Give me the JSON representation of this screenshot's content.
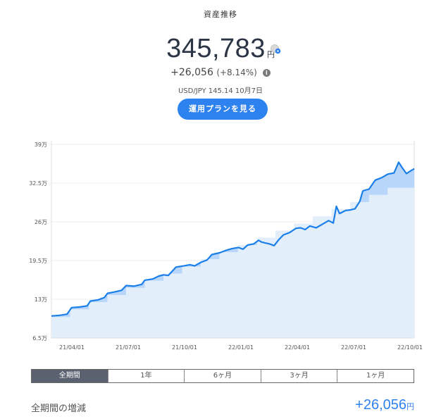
{
  "header": {
    "title": "資産推移"
  },
  "balance": {
    "amount": "345,783",
    "unit": "円"
  },
  "gain": {
    "amount": "+26,056",
    "percent": "(+8.14%)"
  },
  "fx": {
    "text": "USD/JPY 145.14 10月7日"
  },
  "plan_button": {
    "label": "運用プランを見る"
  },
  "tabs": [
    {
      "label": "全期間",
      "active": true
    },
    {
      "label": "1年",
      "active": false
    },
    {
      "label": "6ヶ月",
      "active": false
    },
    {
      "label": "3ヶ月",
      "active": false
    },
    {
      "label": "1ヶ月",
      "active": false
    }
  ],
  "summary": {
    "label": "全期間の増減",
    "value": "+26,056",
    "unit": "円"
  },
  "colors": {
    "accent": "#2e82f0",
    "line": "#1a7fe8",
    "fill_light": "#e3eefb",
    "fill_mid": "#b8d6fa"
  },
  "chart_data": {
    "type": "area",
    "y_ticks": [
      6.5,
      13,
      19.5,
      26,
      32.5,
      39
    ],
    "y_tick_labels": [
      "6.5万",
      "13万",
      "19.5万",
      "26万",
      "32.5万",
      "39万"
    ],
    "ylim": [
      6.5,
      39
    ],
    "x_ticks": [
      3,
      6,
      9,
      12,
      15,
      18,
      21
    ],
    "x_tick_labels": [
      "21/04/01",
      "21/07/01",
      "21/10/01",
      "22/01/01",
      "22/04/01",
      "22/07/01",
      "22/10/01"
    ],
    "xlim": [
      0,
      21.2
    ],
    "series": [
      {
        "values": [
          [
            0,
            10.2
          ],
          [
            0.5,
            10.3
          ],
          [
            1,
            10.5
          ],
          [
            1.3,
            11.6
          ],
          [
            1.8,
            11.7
          ],
          [
            2.3,
            11.9
          ],
          [
            2.5,
            12.7
          ],
          [
            3.0,
            12.9
          ],
          [
            3.4,
            13.3
          ],
          [
            3.6,
            14.0
          ],
          [
            4.0,
            14.2
          ],
          [
            4.5,
            14.5
          ],
          [
            4.8,
            15.3
          ],
          [
            5.3,
            15.2
          ],
          [
            5.8,
            15.5
          ],
          [
            6.0,
            16.2
          ],
          [
            6.5,
            16.4
          ],
          [
            6.9,
            16.9
          ],
          [
            7.2,
            17.1
          ],
          [
            7.5,
            17.0
          ],
          [
            8.0,
            18.4
          ],
          [
            8.5,
            18.6
          ],
          [
            8.9,
            18.8
          ],
          [
            9.2,
            18.6
          ],
          [
            9.6,
            19.2
          ],
          [
            10.0,
            19.6
          ],
          [
            10.3,
            20.5
          ],
          [
            10.8,
            20.8
          ],
          [
            11.2,
            21.2
          ],
          [
            11.6,
            21.5
          ],
          [
            12.0,
            21.7
          ],
          [
            12.3,
            21.4
          ],
          [
            12.6,
            22.1
          ],
          [
            13.0,
            22.3
          ],
          [
            13.3,
            22.9
          ],
          [
            13.5,
            22.6
          ],
          [
            14.0,
            22.3
          ],
          [
            14.3,
            22.0
          ],
          [
            14.6,
            23.0
          ],
          [
            14.9,
            23.8
          ],
          [
            15.3,
            24.2
          ],
          [
            15.7,
            24.9
          ],
          [
            16.0,
            25.0
          ],
          [
            16.3,
            24.7
          ],
          [
            16.6,
            25.3
          ],
          [
            17.0,
            25.0
          ],
          [
            17.4,
            25.6
          ],
          [
            17.8,
            26.2
          ],
          [
            18.1,
            25.8
          ],
          [
            18.3,
            28.6
          ],
          [
            18.5,
            27.4
          ],
          [
            18.9,
            27.9
          ],
          [
            19.2,
            28.0
          ],
          [
            19.5,
            28.2
          ],
          [
            19.8,
            29.4
          ],
          [
            20.0,
            31.2
          ],
          [
            20.4,
            31.5
          ],
          [
            20.8,
            33.0
          ],
          [
            21.2,
            33.4
          ],
          [
            21.6,
            34.0
          ],
          [
            22.0,
            34.2
          ],
          [
            22.3,
            36.0
          ],
          [
            22.5,
            35.2
          ],
          [
            22.8,
            34.1
          ],
          [
            23.1,
            34.6
          ],
          [
            23.3,
            34.9
          ]
        ]
      },
      {
        "values": [
          [
            0,
            10.0
          ],
          [
            1.2,
            10.0
          ],
          [
            1.2,
            11.3
          ],
          [
            2.4,
            11.3
          ],
          [
            2.4,
            12.5
          ],
          [
            3.6,
            12.5
          ],
          [
            3.6,
            13.7
          ],
          [
            4.8,
            13.7
          ],
          [
            4.8,
            14.9
          ],
          [
            6.0,
            14.9
          ],
          [
            6.0,
            16.1
          ],
          [
            7.2,
            16.1
          ],
          [
            7.2,
            17.3
          ],
          [
            8.4,
            17.3
          ],
          [
            8.4,
            18.5
          ],
          [
            9.6,
            18.5
          ],
          [
            9.6,
            19.7
          ],
          [
            10.8,
            19.7
          ],
          [
            10.8,
            20.9
          ],
          [
            12.0,
            20.9
          ],
          [
            12.0,
            22.1
          ],
          [
            13.2,
            22.1
          ],
          [
            13.2,
            23.3
          ],
          [
            14.4,
            23.3
          ],
          [
            14.4,
            24.5
          ],
          [
            15.6,
            24.5
          ],
          [
            15.6,
            25.7
          ],
          [
            16.8,
            25.7
          ],
          [
            16.8,
            26.9
          ],
          [
            18.0,
            26.9
          ],
          [
            18.0,
            28.1
          ],
          [
            19.2,
            28.1
          ],
          [
            19.2,
            29.3
          ],
          [
            20.4,
            29.3
          ],
          [
            20.4,
            30.5
          ],
          [
            21.6,
            30.5
          ],
          [
            21.6,
            31.7
          ],
          [
            23.3,
            31.7
          ]
        ]
      }
    ]
  }
}
